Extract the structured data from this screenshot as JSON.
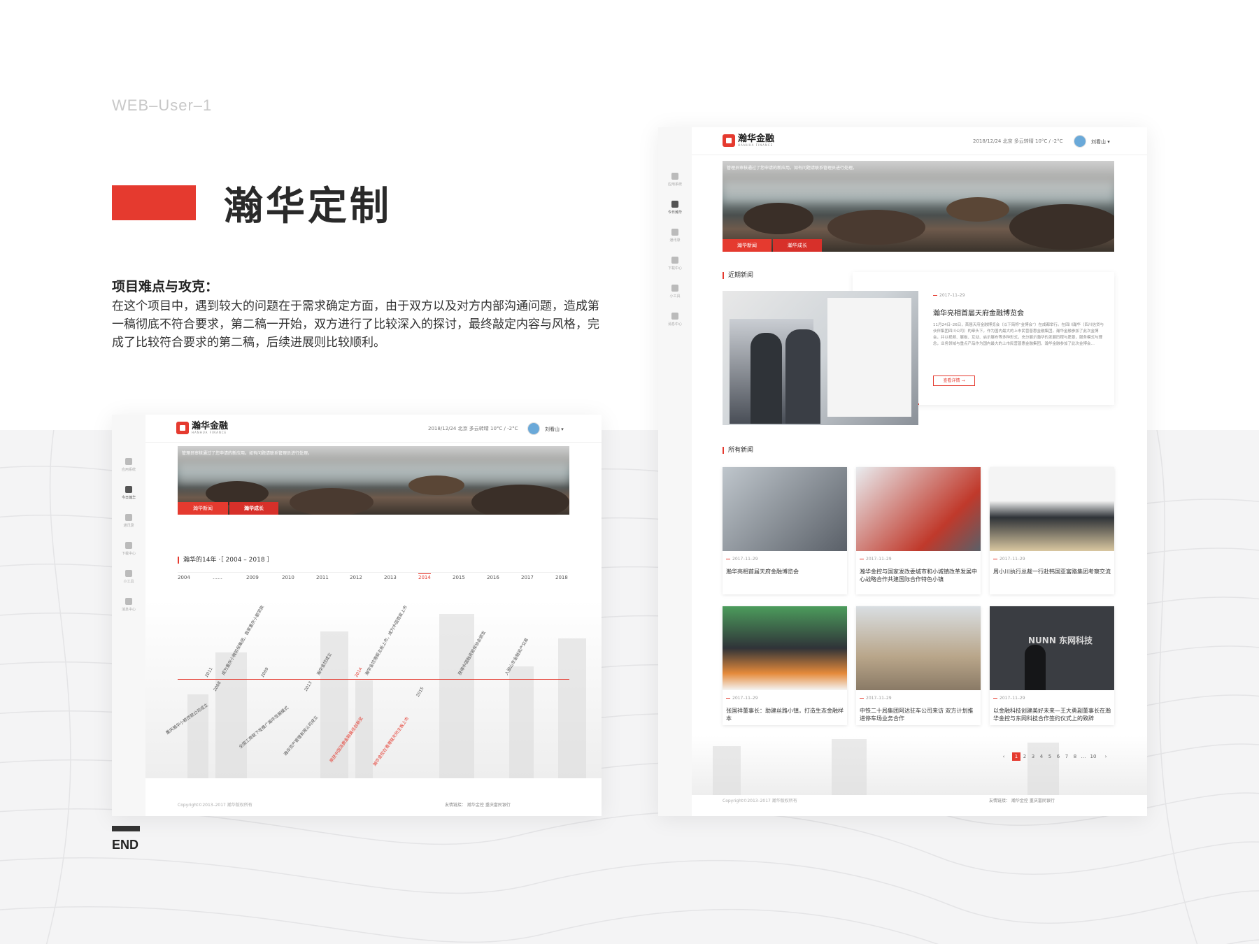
{
  "page": {
    "label": "WEB–User–1",
    "title": "瀚华定制",
    "subhead": "项目难点与攻克：",
    "description": "在这个项目中，遇到较大的问题在于需求确定方面，由于双方以及对方内部沟通问题，造成第一稿彻底不符合要求，第二稿一开始，双方进行了比较深入的探讨，最终敲定内容与风格，完成了比较符合要求的第二稿，后续进展则比较顺利。",
    "end": "END"
  },
  "app": {
    "logo_text": "瀚华金融",
    "logo_sub": "HANHUA FINANCE",
    "top_info": "2018/12/24  北京  多云转晴  10°C / -2°C",
    "user_name": "刘看山",
    "sidebar": [
      "应用系统",
      "今日瀚华",
      "通讯录",
      "下载中心",
      "小工具",
      "消息中心"
    ],
    "banner_note": "管理员审核通过了您申请的新应用。如有问题请联系管理员进行处理。",
    "banner_tabs": [
      "瀚华新闻",
      "瀚华成长"
    ],
    "footer_copy": "Copyright©2013–2017  瀚华版权所有",
    "footer_links": "友情链接：    瀚华金控      重庆富民银行"
  },
  "timeline": {
    "title": "瀚华的14年 ·［ 2004 – 2018 ］",
    "years": [
      "2004",
      "……",
      "2009",
      "2010",
      "2011",
      "2012",
      "2013",
      "2014",
      "2015",
      "2016",
      "2017",
      "2018"
    ],
    "active_year": "2014",
    "events_top": [
      {
        "year": "2011",
        "text": "成为重庆小微担保集团，首家重庆小额贷款"
      },
      {
        "year": "2009",
        "text": "瀚华金控成立"
      },
      {
        "year": "2014",
        "text": "瀚华金控港股主板上市，成为中国首家上市"
      },
      {
        "year": "",
        "text": "获得中国融资担保协会颁发"
      },
      {
        "year": "",
        "text": "入股山东金融资产交易"
      }
    ],
    "events_bottom": [
      {
        "year": "2008",
        "text": "重庆瀚华小额贷款公司成立"
      },
      {
        "year": "2013",
        "text": "全国工商联下发推广瀚华发展模式"
      },
      {
        "year": "",
        "text": "瀚华资产管理有限公司成立"
      },
      {
        "year": "2015",
        "text": "荣获中国消费金融最佳创新奖",
        "red": true
      },
      {
        "year": "",
        "text": "瀚华金控在香港联交所主板上市",
        "red": true
      }
    ]
  },
  "news": {
    "recent_title": "近期新闻",
    "featured": {
      "date": "2017–11–29",
      "title": "瀚华亮相首届天府金融博览会",
      "body": "11月24日–26日，首届天府金融博览会（以下简称“金博会”）在成都举行。在四川瀚华（四川信贷与伙伴集团四川公司）的牵头下，作为国内最大的上市民营普惠金融集团，瀚华金融参加了此次金博会，并以视频、展板、互动、启示展布等多种形式，充分展示瀚华的发展历程与愿景，服务模式与理念，业务领域与重点产品作为国内最大的上市民营普惠金融集团，瀚华金融参加了此次金博会…",
      "button": "查看详情 →"
    },
    "all_title": "所有新闻",
    "cards": [
      {
        "date": "2017–11–29",
        "title": "瀚华亮相首届天府金融博览会"
      },
      {
        "date": "2017–11–29",
        "title": "瀚华金控与国家发改委城市和小城镇改革发展中心战略合作共建国际合作特色小镇"
      },
      {
        "date": "2017–11–29",
        "title": "周小川执行总裁一行赴韩国亚富路集团考察交流"
      },
      {
        "date": "2017–11–29",
        "title": "张国祥董事长：助建丝路小镇，打造生态金融样本"
      },
      {
        "date": "2017–11–29",
        "title": "中铁二十局集团阿达驻车公司来访 双方计划推进停车场业务合作"
      },
      {
        "date": "2017–11–29",
        "title": "以金融科技创建美好未来—王大勇副董事长在瀚华金控与东网科技合作签约仪式上的致辞"
      }
    ],
    "pagination": [
      "‹",
      "1",
      "2",
      "3",
      "4",
      "5",
      "6",
      "7",
      "8",
      "…",
      "10",
      "›"
    ],
    "active_page": "1",
    "sign_text": "NUNN 东网科技"
  },
  "colors": {
    "accent": "#e53a2f",
    "text": "#222222",
    "muted": "#c8c8c8"
  }
}
